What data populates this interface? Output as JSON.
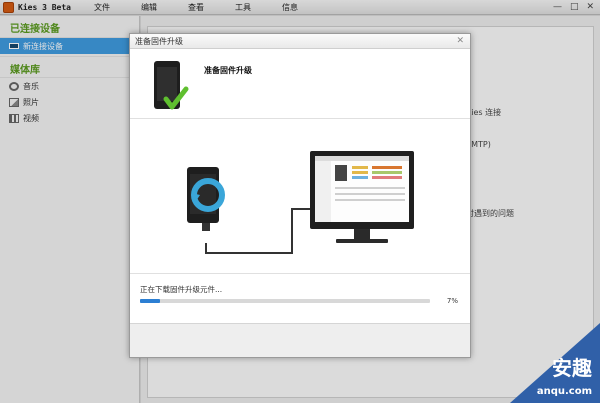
{
  "app": {
    "title": "Kies 3 Beta",
    "menu": [
      "文件",
      "编辑",
      "查看",
      "工具",
      "信息"
    ],
    "window_controls": [
      "—",
      "□",
      "✕"
    ]
  },
  "sidebar": {
    "connected_header": "已连接设备",
    "connected_item": "新连接设备",
    "library_header": "媒体库",
    "library_items": [
      {
        "label": "音乐",
        "icon": "music-icon"
      },
      {
        "label": "照片",
        "icon": "photo-icon"
      },
      {
        "label": "视频",
        "icon": "video-icon"
      }
    ]
  },
  "background": {
    "line1": "Kies 连接",
    "line2": "(MTP)",
    "line3": "时遇到的问题"
  },
  "dialog": {
    "title": "准备固件升级",
    "heading": "准备固件升级",
    "progress_label": "正在下载固件升级元件...",
    "progress_value": 7,
    "progress_text": "7%",
    "close": "✕"
  },
  "watermark": {
    "logo": "安趣",
    "url": "anqu.com"
  },
  "colors": {
    "accent": "#3f9be0",
    "check": "#5fbf2f",
    "header_green": "#5a9a1f",
    "progress": "#2c7fd3"
  }
}
